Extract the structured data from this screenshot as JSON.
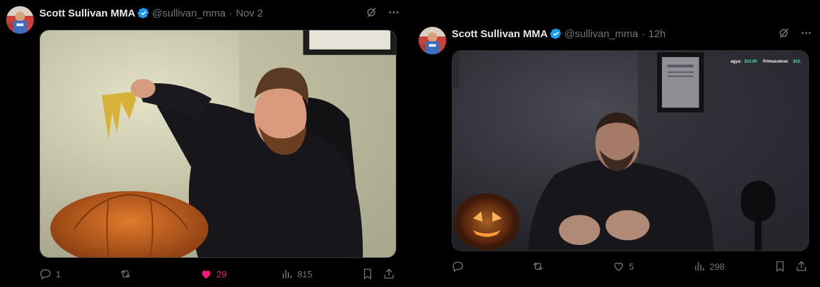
{
  "tweets": [
    {
      "author_name": "Scott Sullivan MMA",
      "handle": "@sullivan_mma",
      "separator": "·",
      "time": "Nov 2",
      "replies": "1",
      "retweets": "",
      "likes": "29",
      "views": "815",
      "liked": true
    },
    {
      "author_name": "Scott Sullivan MMA",
      "handle": "@sullivan_mma",
      "separator": "·",
      "time": "12h",
      "replies": "",
      "retweets": "",
      "likes": "5",
      "views": "298",
      "liked": false,
      "stream_overlay": {
        "donor_1": "agya:",
        "amount_1": "$10.00",
        "donor_2": "Primussteve:",
        "amount_2": "$10."
      }
    }
  ],
  "icons": {
    "verified": "verified-badge-icon",
    "grok": "grok-icon",
    "more": "more-icon",
    "reply": "reply-icon",
    "retweet": "retweet-icon",
    "like": "heart-icon",
    "views": "views-icon",
    "bookmark": "bookmark-icon",
    "share": "share-icon"
  },
  "colors": {
    "background": "#000000",
    "text_primary": "#e7e9ea",
    "text_secondary": "#71767b",
    "verified_blue": "#1d9bf0",
    "like_pink": "#f91880",
    "overlay_green": "#4fe3a4"
  }
}
